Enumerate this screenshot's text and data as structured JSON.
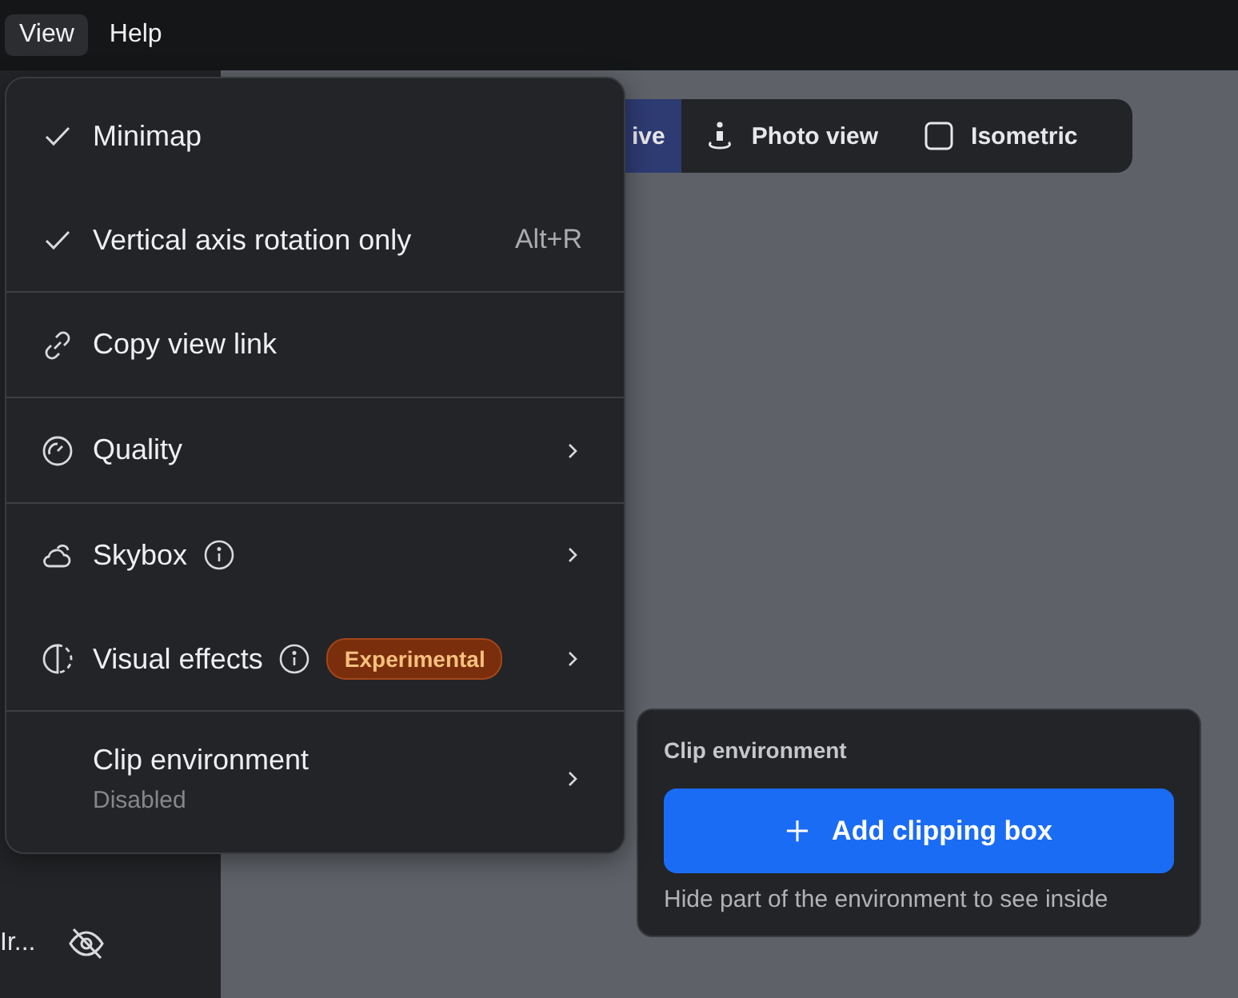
{
  "menubar": [
    {
      "label": "View",
      "selected": true
    },
    {
      "label": "Help",
      "selected": false
    }
  ],
  "view_toolbar": [
    {
      "label": "ive",
      "kind": "text",
      "selected": true
    },
    {
      "label": "Photo view",
      "kind": "person",
      "selected": false
    },
    {
      "label": "Isometric",
      "kind": "cube",
      "selected": false
    }
  ],
  "sidebar": {
    "item": {
      "label": "Ir...",
      "visible": false
    }
  },
  "menu": {
    "sections": [
      [
        {
          "kind": "check",
          "label": "Minimap",
          "checked": true,
          "submenu": false,
          "info": false
        },
        {
          "kind": "check",
          "label": "Vertical axis rotation only",
          "checked": true,
          "shortcut": "Alt+R",
          "submenu": false,
          "info": false
        }
      ],
      [
        {
          "kind": "link",
          "label": "Copy view link",
          "submenu": false,
          "info": false
        }
      ],
      [
        {
          "kind": "gauge",
          "label": "Quality",
          "submenu": true,
          "info": false
        }
      ],
      [
        {
          "kind": "cloud",
          "label": "Skybox",
          "submenu": true,
          "info": true
        },
        {
          "kind": "contrast",
          "label": "Visual effects",
          "submenu": true,
          "info": true,
          "badge": "Experimental"
        }
      ],
      [
        {
          "kind": "plain",
          "label": "Clip environment",
          "subtitle": "Disabled",
          "submenu": true,
          "info": false
        }
      ]
    ]
  },
  "clip_panel": {
    "title": "Clip environment",
    "button": "Add clipping box",
    "hint": "Hide part of the environment to see inside"
  }
}
